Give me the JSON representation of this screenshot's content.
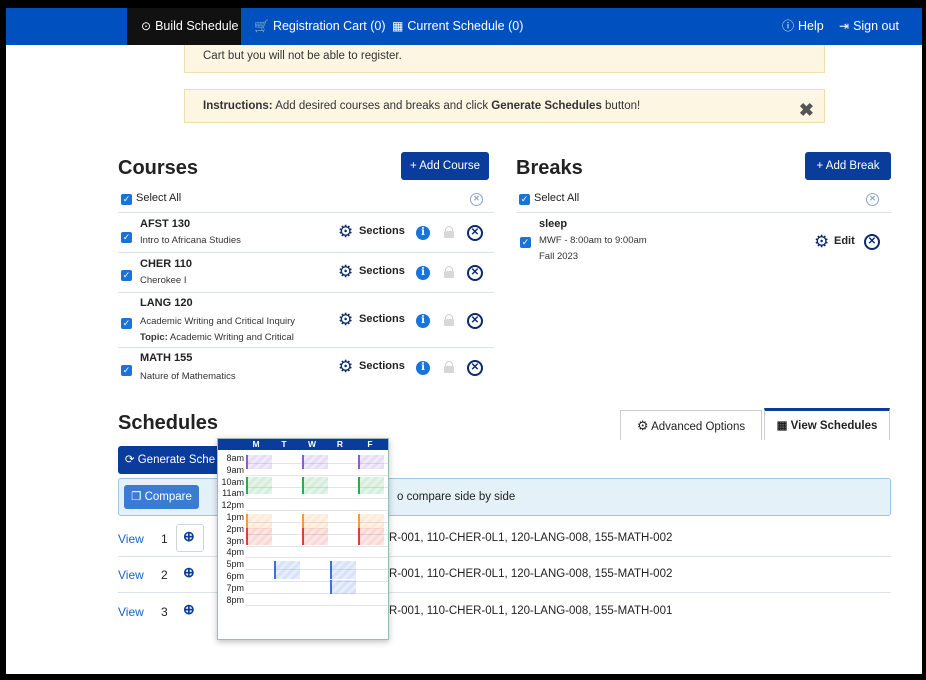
{
  "nav": {
    "build": "Build Schedule",
    "cart": "Registration Cart (0)",
    "current": "Current Schedule (0)",
    "help": "Help",
    "signout": "Sign out"
  },
  "alerts": {
    "cart_text": "Cart but you will not be able to register.",
    "instr_label": "Instructions:",
    "instr_text": " Add desired courses and breaks and click ",
    "instr_bold": "Generate Schedules",
    "instr_end": " button!"
  },
  "courses": {
    "title": "Courses",
    "add_label": "+ Add Course",
    "select_all": "Select All",
    "sections_label": "Sections",
    "items": [
      {
        "code": "AFST 130",
        "name": "Intro to Africana Studies",
        "topic_label": "",
        "topic": ""
      },
      {
        "code": "CHER 110",
        "name": "Cherokee I",
        "topic_label": "",
        "topic": ""
      },
      {
        "code": "LANG 120",
        "name": "Academic Writing and Critical Inquiry",
        "topic_label": "Topic:",
        "topic": " Academic Writing and Critical"
      },
      {
        "code": "MATH 155",
        "name": "Nature of Mathematics",
        "topic_label": "",
        "topic": ""
      }
    ]
  },
  "breaks": {
    "title": "Breaks",
    "add_label": "+ Add Break",
    "select_all": "Select All",
    "items": [
      {
        "name": "sleep",
        "time": "MWF - 8:00am to 9:00am",
        "term": "Fall 2023",
        "edit_label": "Edit"
      }
    ]
  },
  "schedules": {
    "title": "Schedules",
    "generate_label": "Generate Sche",
    "advanced_label": "Advanced Options",
    "view_label": "View Schedules",
    "compare_label": "Compare",
    "compare_hint": "o compare side by side",
    "view_link": "View",
    "rows": [
      {
        "num": "1",
        "sections": "R-001, 110-CHER-0L1, 120-LANG-008, 155-MATH-002"
      },
      {
        "num": "2",
        "sections": "R-001, 110-CHER-0L1, 120-LANG-008, 155-MATH-002"
      },
      {
        "num": "3",
        "sections": "R-001, 110-CHER-0L1, 120-LANG-008, 155-MATH-001"
      }
    ]
  },
  "calendar": {
    "days": [
      "M",
      "T",
      "W",
      "R",
      "F"
    ],
    "hours": [
      "8am",
      "9am",
      "10am",
      "11am",
      "12pm",
      "1pm",
      "2pm",
      "3pm",
      "4pm",
      "5pm",
      "6pm",
      "7pm",
      "8pm"
    ],
    "colors": {
      "purple": "#8a5cd6",
      "green": "#2fa84f",
      "orange": "#f59a3c",
      "red": "#e23b3b",
      "blue": "#3d6fe0"
    }
  },
  "icons": [
    "clock-icon",
    "cart-icon",
    "calendar-icon",
    "help-icon",
    "signout-icon",
    "gear-icon",
    "info-icon",
    "lock-icon",
    "remove-circle-icon",
    "refresh-icon",
    "gears-icon",
    "zoom-in-icon",
    "copy-icon",
    "close-icon"
  ]
}
